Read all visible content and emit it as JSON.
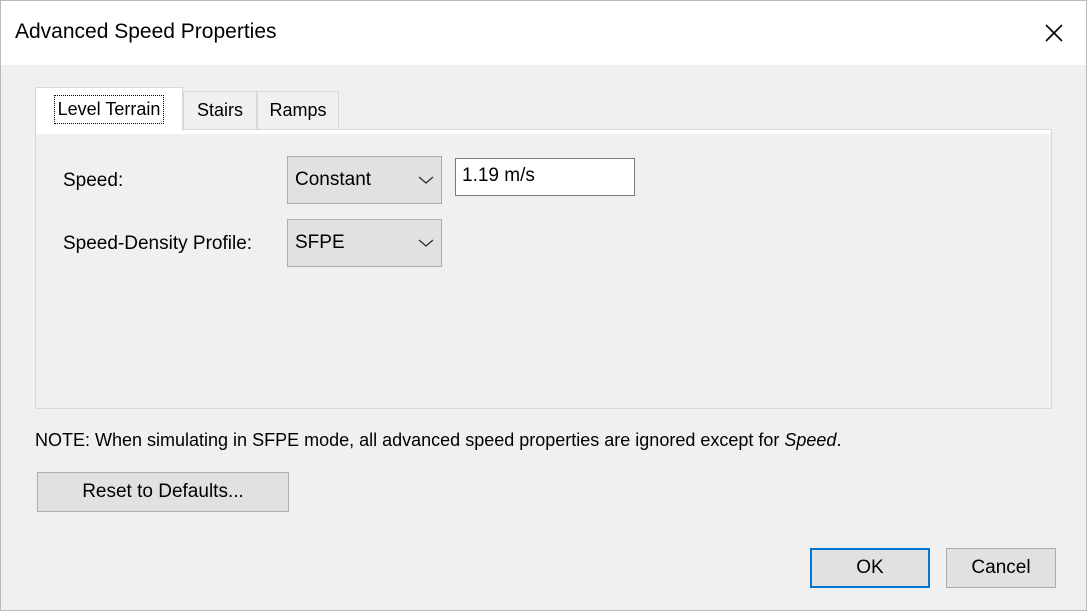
{
  "window": {
    "title": "Advanced Speed Properties"
  },
  "tabs": [
    {
      "label": "Level Terrain",
      "selected": true
    },
    {
      "label": "Stairs",
      "selected": false
    },
    {
      "label": "Ramps",
      "selected": false
    }
  ],
  "level_terrain": {
    "speed_label": "Speed:",
    "speed_mode": "Constant",
    "speed_value": "1.19 m/s",
    "profile_label": "Speed-Density Profile:",
    "profile_value": "SFPE"
  },
  "note": {
    "prefix": "NOTE: When simulating in SFPE mode, all advanced speed properties are ignored except for ",
    "emphasis": "Speed",
    "suffix": "."
  },
  "buttons": {
    "reset": "Reset to Defaults...",
    "ok": "OK",
    "cancel": "Cancel"
  },
  "icons": {
    "close": "close-icon",
    "dropdown": "chevron-down-icon"
  },
  "colors": {
    "title_bg": "#ffffff",
    "dialog_bg": "#f0f0f0",
    "button_bg": "#e1e1e1",
    "default_button_border": "#0078d7"
  }
}
